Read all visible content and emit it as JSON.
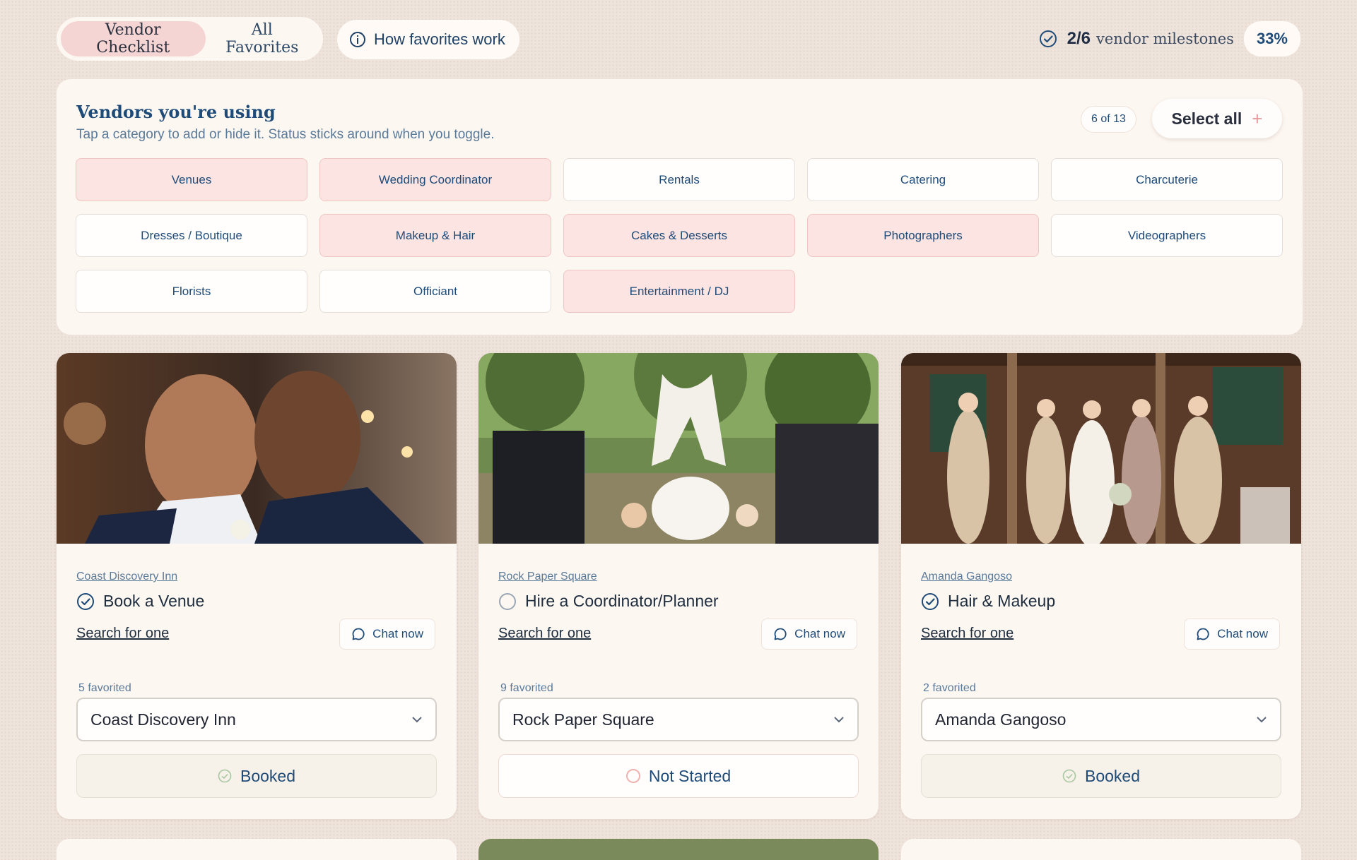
{
  "tabs": [
    {
      "label": "Vendor Checklist",
      "active": true
    },
    {
      "label": "All Favorites",
      "active": false
    }
  ],
  "how_button": {
    "label": "How favorites work",
    "icon": "info-icon"
  },
  "milestones": {
    "count": "2/6",
    "label": "vendor milestones",
    "percent": "33%"
  },
  "vendors_panel": {
    "title": "Vendors you're using",
    "subtitle": "Tap a category to add or hide it. Status sticks around when you toggle.",
    "count": "6 of 13",
    "select_all": "Select all",
    "categories": [
      {
        "label": "Venues",
        "on": true
      },
      {
        "label": "Wedding Coordinator",
        "on": true
      },
      {
        "label": "Rentals",
        "on": false
      },
      {
        "label": "Catering",
        "on": false
      },
      {
        "label": "Charcuterie",
        "on": false
      },
      {
        "label": "Dresses / Boutique",
        "on": false
      },
      {
        "label": "Makeup & Hair",
        "on": true
      },
      {
        "label": "Cakes & Desserts",
        "on": true
      },
      {
        "label": "Photographers",
        "on": true
      },
      {
        "label": "Videographers",
        "on": false
      },
      {
        "label": "Florists",
        "on": false
      },
      {
        "label": "Officiant",
        "on": false
      },
      {
        "label": "Entertainment / DJ",
        "on": true
      }
    ]
  },
  "cards": [
    {
      "vendor": "Coast Discovery Inn",
      "task": "Book a Venue",
      "done": true,
      "search": "Search for one",
      "chat": "Chat now",
      "favorited": "5 favorited",
      "selected": "Coast Discovery Inn",
      "status": "Booked"
    },
    {
      "vendor": "Rock Paper Square",
      "task": "Hire a Coordinator/Planner",
      "done": false,
      "search": "Search for one",
      "chat": "Chat now",
      "favorited": "9 favorited",
      "selected": "Rock Paper Square",
      "status": "Not Started"
    },
    {
      "vendor": "Amanda Gangoso",
      "task": "Hair & Makeup",
      "done": true,
      "search": "Search for one",
      "chat": "Chat now",
      "favorited": "2 favorited",
      "selected": "Amanda Gangoso",
      "status": "Booked"
    }
  ],
  "colors": {
    "accent": "#1f4b78",
    "chip_on": "#fbe4e2",
    "panel": "#fdf7f2",
    "background": "#efe4dc"
  }
}
